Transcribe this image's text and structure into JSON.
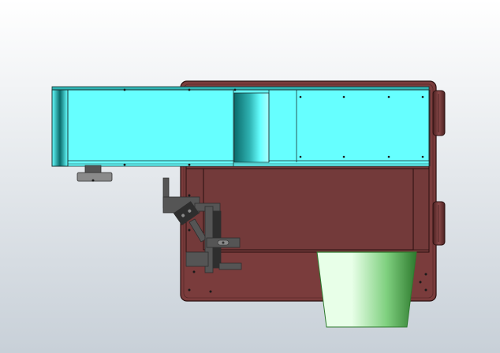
{
  "viewport": {
    "background_top": "#ffffff",
    "background_bottom": "#c8d0d8"
  },
  "colors": {
    "frame_fill": "#7a3c3c",
    "frame_dark": "#4a2020",
    "frame_edge": "#2a1010",
    "panel_fill": "#733a3a",
    "belt_fill": "#66ffff",
    "belt_shade": "#2fb3b3",
    "belt_edge": "#1a3030",
    "roller_light": "#aaffff",
    "roller_dark": "#0a6a6a",
    "mount_gray": "#555555",
    "mount_dark": "#2e2e2e",
    "mount_light": "#8a8a8a",
    "hopper_light": "#e8ffe8",
    "hopper_mid": "#7fd07f",
    "hopper_dark": "#2e7a2e",
    "handle_fill": "#8a4a4a",
    "hole_color": "#1a1a1a"
  },
  "icons": {
    "motor": "motor-icon",
    "bolt": "bolt-hole-icon",
    "handle": "handle-icon",
    "hopper": "hopper-icon"
  }
}
